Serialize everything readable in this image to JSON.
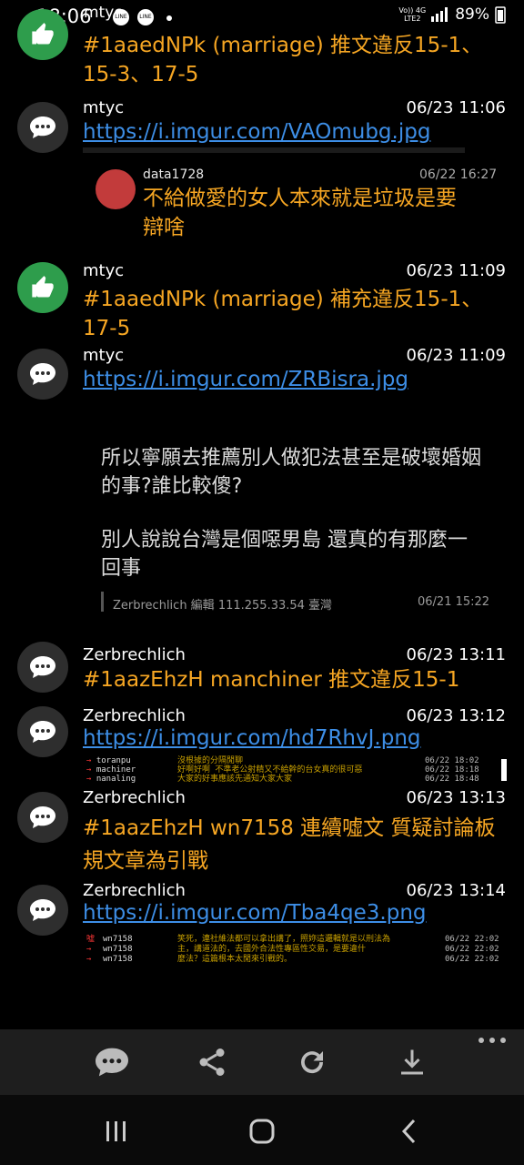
{
  "status_bar": {
    "time": "18:06",
    "app": "mtyc",
    "battery": "89%",
    "net_top": "Vo)) 4G",
    "net_bottom": "LTE2"
  },
  "messages": [
    {
      "sender": "",
      "time": "06/23 11:06",
      "text": "#1aaedNPk (marriage) 推文違反15-1、15-3、17-5"
    },
    {
      "sender": "mtyc",
      "time": "06/23 11:06",
      "link": "https://i.imgur.com/VAOmubg.jpg",
      "preview": {
        "user": "data1728",
        "time": "06/22 16:27",
        "text": "不給做愛的女人本來就是垃圾是要辯啥"
      }
    },
    {
      "sender": "mtyc",
      "time": "06/23 11:09",
      "text": "#1aaedNPk (marriage) 補充違反15-1、17-5"
    },
    {
      "sender": "mtyc",
      "time": "06/23 11:09",
      "link": "https://i.imgur.com/ZRBisra.jpg",
      "preview": {
        "line1": "所以寧願去推薦別人做犯法甚至是破壞婚姻的事?誰比較傻?",
        "line2": "別人說說台灣是個噁男島 還真的有那麼一回事",
        "meta": "Zerbrechlich 編輯 111.255.33.54 臺灣",
        "meta_time": "06/21 15:22"
      }
    },
    {
      "sender": "Zerbrechlich",
      "time": "06/23 13:11",
      "text": "#1aazEhzH manchiner 推文違反15-1"
    },
    {
      "sender": "Zerbrechlich",
      "time": "06/23 13:12",
      "link": "https://i.imgur.com/hd7RhvJ.png",
      "ptt": [
        {
          "user": "toranpu",
          "text": "沒根據的分隔閒聊",
          "date": "06/22 18:02"
        },
        {
          "user": "machiner",
          "text": "好啊好啊 不準老公射精又不給幹的台女真的很可惡",
          "date": "06/22 18:18"
        },
        {
          "user": "nanaling",
          "text": "大家的好事應該先通知大家大家",
          "date": "06/22 18:48"
        }
      ]
    },
    {
      "sender": "Zerbrechlich",
      "time": "06/23 13:13",
      "text": "#1aazEhzH wn7158 連續噓文 質疑討論板規文章為引戰"
    },
    {
      "sender": "Zerbrechlich",
      "time": "06/23 13:14",
      "link": "https://i.imgur.com/Tba4qe3.png",
      "ptt": [
        {
          "tag": "噓",
          "user": "wn7158",
          "text": "笑死，連社維法都可以拿出講了，照妳這邏輯就是以刑法為",
          "date": "06/22 22:02"
        },
        {
          "tag": "→",
          "user": "wn7158",
          "text": "主，講道法的，去國外合法性專區性交易，是要違什",
          "date": "06/22 22:02"
        },
        {
          "tag": "→",
          "user": "wn7158",
          "text": "麼法？這篇根本太閒來引戰的。",
          "date": "06/22 22:02"
        }
      ]
    }
  ],
  "icons": {
    "like": "thumbs-up-icon",
    "comment": "comment-icon"
  },
  "colors": {
    "accent_text": "#f6a623",
    "link": "#3d8ee6",
    "like_bg": "#2e9d4c",
    "comment_bg": "#2e2e2e"
  }
}
